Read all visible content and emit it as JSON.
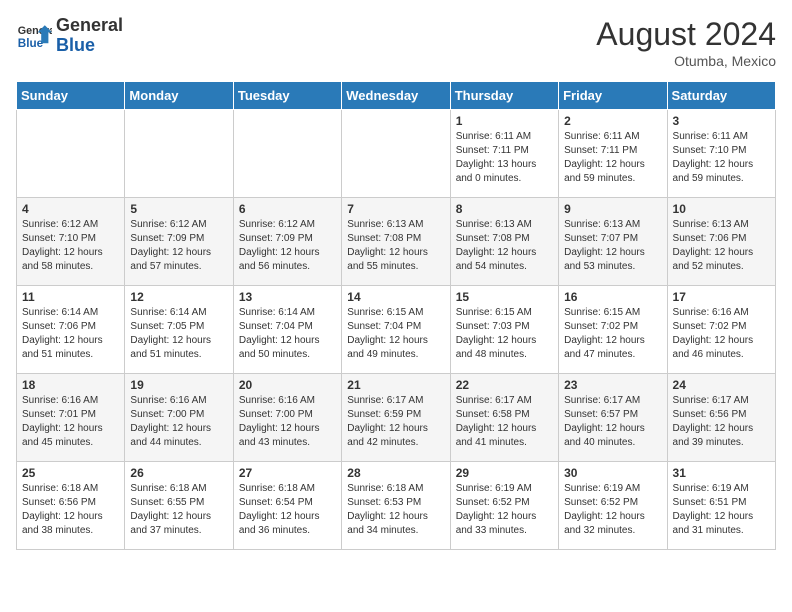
{
  "header": {
    "logo_line1": "General",
    "logo_line2": "Blue",
    "month_year": "August 2024",
    "location": "Otumba, Mexico"
  },
  "days_of_week": [
    "Sunday",
    "Monday",
    "Tuesday",
    "Wednesday",
    "Thursday",
    "Friday",
    "Saturday"
  ],
  "weeks": [
    [
      {
        "day": "",
        "info": ""
      },
      {
        "day": "",
        "info": ""
      },
      {
        "day": "",
        "info": ""
      },
      {
        "day": "",
        "info": ""
      },
      {
        "day": "1",
        "info": "Sunrise: 6:11 AM\nSunset: 7:11 PM\nDaylight: 13 hours\nand 0 minutes."
      },
      {
        "day": "2",
        "info": "Sunrise: 6:11 AM\nSunset: 7:11 PM\nDaylight: 12 hours\nand 59 minutes."
      },
      {
        "day": "3",
        "info": "Sunrise: 6:11 AM\nSunset: 7:10 PM\nDaylight: 12 hours\nand 59 minutes."
      }
    ],
    [
      {
        "day": "4",
        "info": "Sunrise: 6:12 AM\nSunset: 7:10 PM\nDaylight: 12 hours\nand 58 minutes."
      },
      {
        "day": "5",
        "info": "Sunrise: 6:12 AM\nSunset: 7:09 PM\nDaylight: 12 hours\nand 57 minutes."
      },
      {
        "day": "6",
        "info": "Sunrise: 6:12 AM\nSunset: 7:09 PM\nDaylight: 12 hours\nand 56 minutes."
      },
      {
        "day": "7",
        "info": "Sunrise: 6:13 AM\nSunset: 7:08 PM\nDaylight: 12 hours\nand 55 minutes."
      },
      {
        "day": "8",
        "info": "Sunrise: 6:13 AM\nSunset: 7:08 PM\nDaylight: 12 hours\nand 54 minutes."
      },
      {
        "day": "9",
        "info": "Sunrise: 6:13 AM\nSunset: 7:07 PM\nDaylight: 12 hours\nand 53 minutes."
      },
      {
        "day": "10",
        "info": "Sunrise: 6:13 AM\nSunset: 7:06 PM\nDaylight: 12 hours\nand 52 minutes."
      }
    ],
    [
      {
        "day": "11",
        "info": "Sunrise: 6:14 AM\nSunset: 7:06 PM\nDaylight: 12 hours\nand 51 minutes."
      },
      {
        "day": "12",
        "info": "Sunrise: 6:14 AM\nSunset: 7:05 PM\nDaylight: 12 hours\nand 51 minutes."
      },
      {
        "day": "13",
        "info": "Sunrise: 6:14 AM\nSunset: 7:04 PM\nDaylight: 12 hours\nand 50 minutes."
      },
      {
        "day": "14",
        "info": "Sunrise: 6:15 AM\nSunset: 7:04 PM\nDaylight: 12 hours\nand 49 minutes."
      },
      {
        "day": "15",
        "info": "Sunrise: 6:15 AM\nSunset: 7:03 PM\nDaylight: 12 hours\nand 48 minutes."
      },
      {
        "day": "16",
        "info": "Sunrise: 6:15 AM\nSunset: 7:02 PM\nDaylight: 12 hours\nand 47 minutes."
      },
      {
        "day": "17",
        "info": "Sunrise: 6:16 AM\nSunset: 7:02 PM\nDaylight: 12 hours\nand 46 minutes."
      }
    ],
    [
      {
        "day": "18",
        "info": "Sunrise: 6:16 AM\nSunset: 7:01 PM\nDaylight: 12 hours\nand 45 minutes."
      },
      {
        "day": "19",
        "info": "Sunrise: 6:16 AM\nSunset: 7:00 PM\nDaylight: 12 hours\nand 44 minutes."
      },
      {
        "day": "20",
        "info": "Sunrise: 6:16 AM\nSunset: 7:00 PM\nDaylight: 12 hours\nand 43 minutes."
      },
      {
        "day": "21",
        "info": "Sunrise: 6:17 AM\nSunset: 6:59 PM\nDaylight: 12 hours\nand 42 minutes."
      },
      {
        "day": "22",
        "info": "Sunrise: 6:17 AM\nSunset: 6:58 PM\nDaylight: 12 hours\nand 41 minutes."
      },
      {
        "day": "23",
        "info": "Sunrise: 6:17 AM\nSunset: 6:57 PM\nDaylight: 12 hours\nand 40 minutes."
      },
      {
        "day": "24",
        "info": "Sunrise: 6:17 AM\nSunset: 6:56 PM\nDaylight: 12 hours\nand 39 minutes."
      }
    ],
    [
      {
        "day": "25",
        "info": "Sunrise: 6:18 AM\nSunset: 6:56 PM\nDaylight: 12 hours\nand 38 minutes."
      },
      {
        "day": "26",
        "info": "Sunrise: 6:18 AM\nSunset: 6:55 PM\nDaylight: 12 hours\nand 37 minutes."
      },
      {
        "day": "27",
        "info": "Sunrise: 6:18 AM\nSunset: 6:54 PM\nDaylight: 12 hours\nand 36 minutes."
      },
      {
        "day": "28",
        "info": "Sunrise: 6:18 AM\nSunset: 6:53 PM\nDaylight: 12 hours\nand 34 minutes."
      },
      {
        "day": "29",
        "info": "Sunrise: 6:19 AM\nSunset: 6:52 PM\nDaylight: 12 hours\nand 33 minutes."
      },
      {
        "day": "30",
        "info": "Sunrise: 6:19 AM\nSunset: 6:52 PM\nDaylight: 12 hours\nand 32 minutes."
      },
      {
        "day": "31",
        "info": "Sunrise: 6:19 AM\nSunset: 6:51 PM\nDaylight: 12 hours\nand 31 minutes."
      }
    ]
  ]
}
